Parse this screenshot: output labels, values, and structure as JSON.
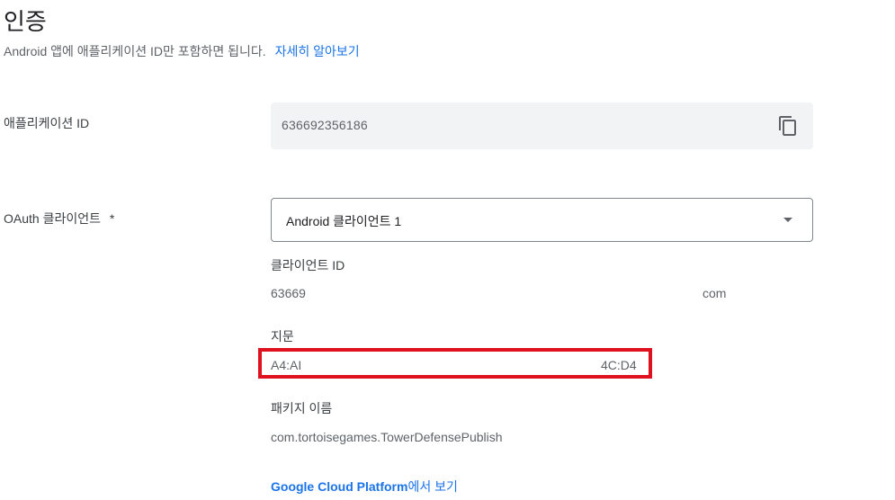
{
  "header": {
    "title": "인증",
    "subtitle": "Android 앱에 애플리케이션 ID만 포함하면 됩니다.",
    "learn_more": "자세히 알아보기"
  },
  "app_id": {
    "label": "애플리케이션 ID",
    "value": "636692356186",
    "copy_icon": "copy-icon"
  },
  "oauth": {
    "label": "OAuth 클라이언트",
    "required_mark": "*",
    "selected": "Android 클라이언트 1",
    "dropdown_icon": "arrow-drop-down-icon"
  },
  "client_id": {
    "label": "클라이언트 ID",
    "value_start": "63669",
    "value_end": "com"
  },
  "fingerprint": {
    "label": "지문",
    "value_start": "A4:AI",
    "value_end": "4C:D4",
    "highlight_color": "#e0111f"
  },
  "package": {
    "label": "패키지 이름",
    "value": "com.tortoisegames.TowerDefensePublish"
  },
  "gcp": {
    "link_brand": "Google Cloud Platform",
    "link_suffix": "에서 보기"
  },
  "colors": {
    "link": "#1a73e8",
    "field_bg": "#f1f3f4"
  }
}
